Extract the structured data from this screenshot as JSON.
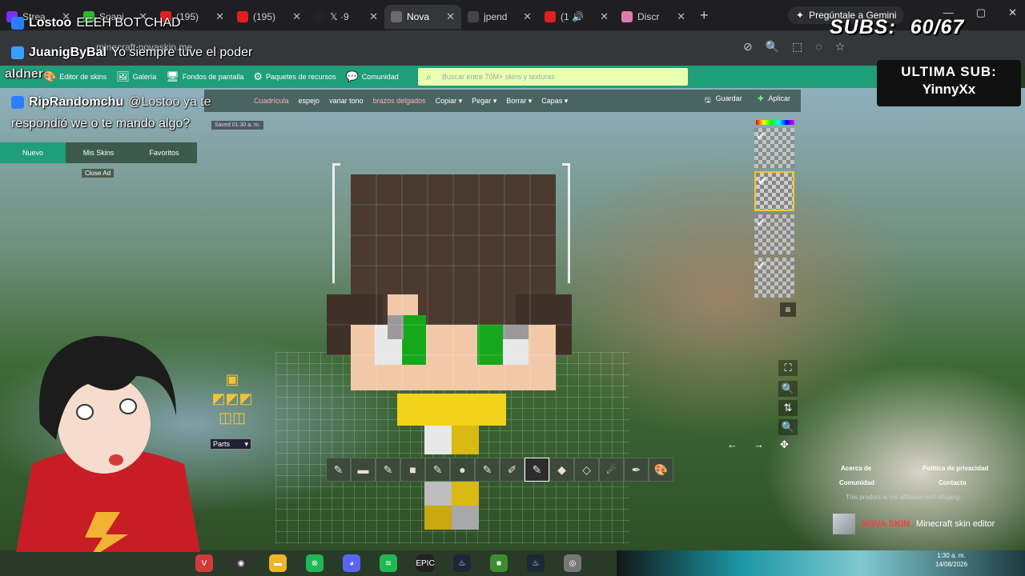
{
  "browser": {
    "tabs": [
      {
        "label": "Strea",
        "color": "#7b2cff"
      },
      {
        "label": "Soapi",
        "color": "#2eb82e"
      },
      {
        "label": "(195)",
        "color": "#e02020"
      },
      {
        "label": "(195)",
        "color": "#e02020"
      },
      {
        "label": "𝕏 ·9",
        "color": "#222"
      },
      {
        "label": "Nova",
        "color": "#6b6b6b"
      },
      {
        "label": "jpend",
        "color": "#444"
      },
      {
        "label": "(1 🔊",
        "color": "#e02020"
      },
      {
        "label": "Discr",
        "color": "#e07bb0"
      }
    ],
    "new_tab": "+",
    "gemini_button": "Pregúntale a Gemini",
    "url": "minecraft.novaskin.me",
    "window_controls": [
      "—",
      "▢",
      "✕"
    ]
  },
  "site_nav": {
    "items": [
      {
        "icon": "palette-icon",
        "glyph": "🎨",
        "label": "Editor de skins"
      },
      {
        "icon": "gallery-icon",
        "glyph": "🖼",
        "label": "Galería"
      },
      {
        "icon": "wallpaper-icon",
        "glyph": "🖥",
        "label": "Fondos de pantalla"
      },
      {
        "icon": "gear-icon",
        "glyph": "⚙",
        "label": "Paquetes de recursos"
      },
      {
        "icon": "community-icon",
        "glyph": "💬",
        "label": "Comunidad"
      }
    ],
    "search_placeholder": "Buscar entre 70M+ skins y texturas"
  },
  "edit_toolbar": {
    "items": [
      {
        "label": "Cuadrícula",
        "style": "red"
      },
      {
        "label": "espejo",
        "style": ""
      },
      {
        "label": "variar tono",
        "style": ""
      },
      {
        "label": "brazos delgados",
        "style": "red"
      },
      {
        "label": "Copiar ▾",
        "style": ""
      },
      {
        "label": "Pegar ▾",
        "style": ""
      },
      {
        "label": "Borrar ▾",
        "style": ""
      },
      {
        "label": "Capas ▾",
        "style": ""
      }
    ],
    "save": "Guardar",
    "apply": "Aplicar",
    "saved_note": "Saved 01:30 a. m."
  },
  "left_panel": {
    "tabs": [
      "Nuevo",
      "Mis Skins",
      "Favoritos"
    ],
    "close_ad": "Close Ad"
  },
  "parts_select": "Parts",
  "right_controls": [
    {
      "icon": "fullscreen-icon",
      "glyph": "⛶"
    },
    {
      "icon": "zoom-in-icon",
      "glyph": "🔍"
    },
    {
      "icon": "swap-icon",
      "glyph": "⇅"
    },
    {
      "icon": "zoom-out-icon",
      "glyph": "🔍"
    }
  ],
  "arrows": [
    "←",
    "→",
    "✥"
  ],
  "tools": [
    {
      "name": "pencil-tool",
      "glyph": "✎"
    },
    {
      "name": "stamp-tool",
      "glyph": "▬"
    },
    {
      "name": "pencil-tool-2",
      "glyph": "✎"
    },
    {
      "name": "block-tool",
      "glyph": "■"
    },
    {
      "name": "pencil-tool-3",
      "glyph": "✎"
    },
    {
      "name": "circle-tool",
      "glyph": "●"
    },
    {
      "name": "pencil-tool-4",
      "glyph": "✎"
    },
    {
      "name": "brush-tool",
      "glyph": "✐"
    },
    {
      "name": "pencil-tool-5",
      "glyph": "✎"
    },
    {
      "name": "fill-tool",
      "glyph": "◆"
    },
    {
      "name": "eraser-tool",
      "glyph": "◇"
    },
    {
      "name": "smudge-tool",
      "glyph": "☄"
    },
    {
      "name": "eyedropper-tool",
      "glyph": "✒"
    },
    {
      "name": "palette-tool",
      "glyph": "🎨"
    }
  ],
  "footer": {
    "about": "Acerca de",
    "contact_company": "Comunidad",
    "privacy": "Política de privacidad",
    "contact": "Contacto",
    "affiliation": "This product is not affiliated with Mojang.",
    "brand": "NOVA SKIN",
    "brand_tag": "Minecraft skin editor"
  },
  "stream": {
    "chat": [
      {
        "user": "Lostoo",
        "message": "EEEH BOT CHAD",
        "badge_color": "#2a7fff"
      },
      {
        "user": "JuanigByBal",
        "message": "Yo siempre tuve el poder",
        "badge_color": "#3aa0ff"
      },
      {
        "user": "aldner",
        "message": "",
        "badge_color": "#9a9a9a"
      },
      {
        "user": "RipRandomchu",
        "message": "@Lostoo ya te",
        "badge_color": "#2a7fff"
      },
      {
        "user": "",
        "message": "respondió we o te mando algo?",
        "badge_color": ""
      }
    ],
    "subs_label": "SUBS:",
    "subs_value": "60/67",
    "last_sub_label": "ULTIMA SUB:",
    "last_sub_name": "YinnyXx"
  },
  "taskbar": {
    "apps": [
      {
        "name": "valorant-icon",
        "glyph": "V",
        "color": "#d23a3a"
      },
      {
        "name": "obs-icon",
        "glyph": "◉",
        "color": "#333"
      },
      {
        "name": "folder-icon",
        "glyph": "▬",
        "color": "#f0b429"
      },
      {
        "name": "xbox-icon",
        "glyph": "⊗",
        "color": "#1db954"
      },
      {
        "name": "discord-icon",
        "glyph": "◕",
        "color": "#5865f2"
      },
      {
        "name": "spotify-icon",
        "glyph": "≋",
        "color": "#1db954"
      },
      {
        "name": "epic-games-icon",
        "glyph": "EPIC",
        "color": "#222"
      },
      {
        "name": "steam-icon",
        "glyph": "♨",
        "color": "#1b2838"
      },
      {
        "name": "minecraft-icon",
        "glyph": "■",
        "color": "#3c8d2f"
      },
      {
        "name": "steam-icon-2",
        "glyph": "♨",
        "color": "#1b2838"
      },
      {
        "name": "chrome-icon",
        "glyph": "◎",
        "color": "#777"
      }
    ],
    "time": "1:30 a. m.",
    "date": "14/08/2026"
  }
}
